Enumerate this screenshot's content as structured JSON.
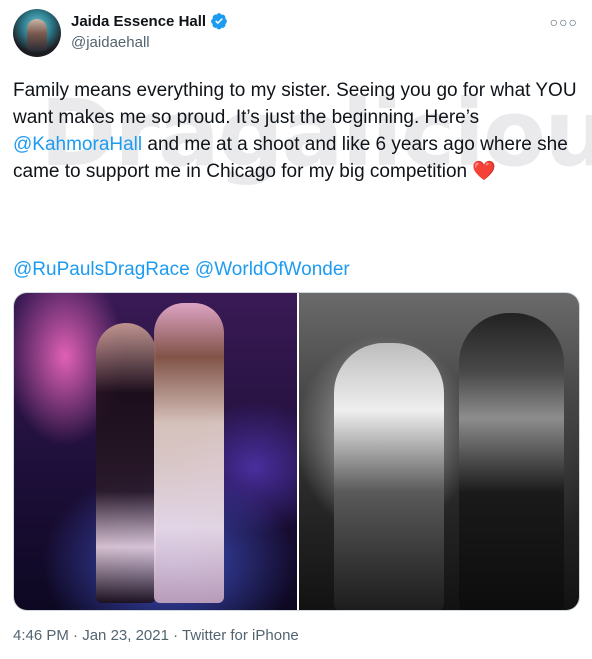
{
  "author": {
    "display_name": "Jaida Essence Hall",
    "handle": "@jaidaehall",
    "verified_icon": "verified-badge-icon",
    "verified_color": "#1d9bf0"
  },
  "more_icon": "more-options-icon",
  "tweet": {
    "line1_a": "Family means everything to my sister. Seeing you go for what YOU want makes me so proud. It’s just the beginning. Here’s ",
    "mention_1": "@KahmoraHall",
    "line1_b": " and me at a shoot and like 6 years ago where she came to support me in Chicago for my big competition ",
    "heart": "❤️",
    "mention_2": "@RuPaulsDragRace",
    "mention_3": "@WorldOfWonder"
  },
  "watermark": "Dragalicious",
  "media": {
    "photos": [
      "photo-1",
      "photo-2"
    ]
  },
  "meta": {
    "time": "4:46 PM",
    "date": "Jan 23, 2021",
    "source": "Twitter for iPhone",
    "separator": " · "
  },
  "colors": {
    "link": "#1d9bf0",
    "secondary_text": "#536471",
    "heart": "#e0245e"
  }
}
